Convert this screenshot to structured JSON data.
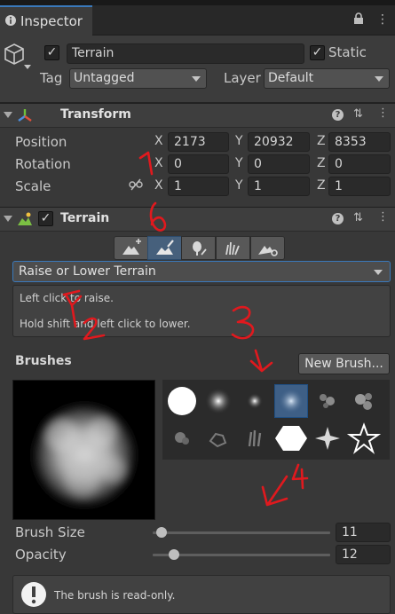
{
  "window": {
    "tab_title": "Inspector",
    "lock_icon": "lock-icon",
    "menu_icon": "vertical-ellipsis-icon"
  },
  "object": {
    "name": "Terrain",
    "active": true,
    "static_label": "Static",
    "static": true,
    "tag_label": "Tag",
    "tag_value": "Untagged",
    "layer_label": "Layer",
    "layer_value": "Default"
  },
  "transform": {
    "title": "Transform",
    "position_label": "Position",
    "rotation_label": "Rotation",
    "scale_label": "Scale",
    "axis_x": "X",
    "axis_y": "Y",
    "axis_z": "Z",
    "position": {
      "x": "2173",
      "y": "20932",
      "z": "8353"
    },
    "rotation": {
      "x": "0",
      "y": "0",
      "z": "0"
    },
    "scale": {
      "x": "1",
      "y": "1",
      "z": "1"
    }
  },
  "terrain": {
    "title": "Terrain",
    "enabled": true,
    "tools": [
      "create-neighbor-terrains",
      "paint-terrain",
      "paint-trees",
      "paint-details",
      "terrain-settings"
    ],
    "selected_tool": "paint-terrain",
    "mode": "Raise or Lower Terrain",
    "help_line1": "Left click to raise.",
    "help_line2": "Hold shift and left click to lower.",
    "brushes_label": "Brushes",
    "new_brush_label": "New Brush...",
    "brush_size_label": "Brush Size",
    "brush_size": "11",
    "brush_size_fraction": 0.05,
    "opacity_label": "Opacity",
    "opacity": "12",
    "opacity_fraction": 0.12,
    "readonly_message": "The brush is read-only."
  },
  "annotations": {
    "color": "#e0191e",
    "labels": [
      "1",
      "2",
      "3",
      "4"
    ]
  }
}
